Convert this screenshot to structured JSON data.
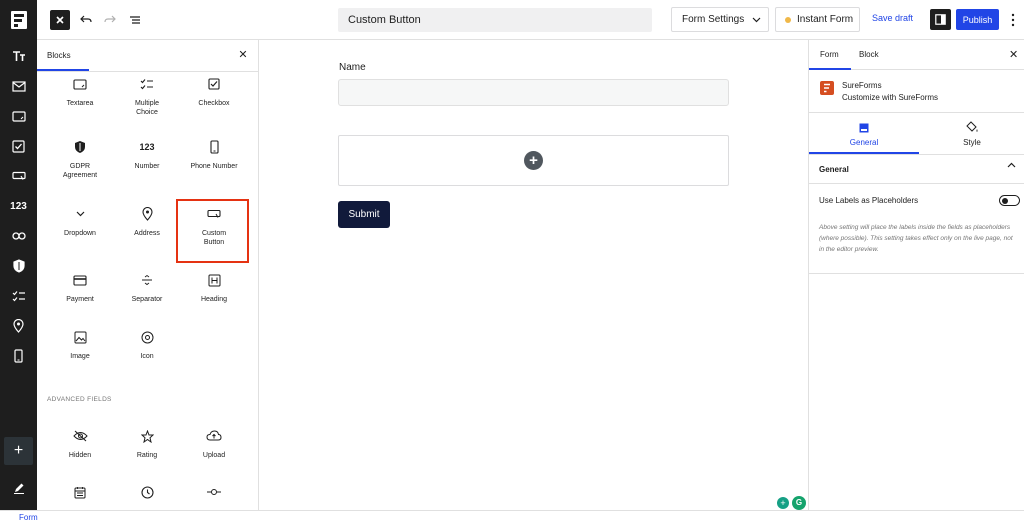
{
  "topbar": {
    "title": "Custom Button",
    "form_settings": "Form Settings",
    "instant_form": "Instant Form",
    "save_draft": "Save draft",
    "publish": "Publish"
  },
  "rail": {
    "number_label": "123"
  },
  "blocks_panel": {
    "tab": "Blocks",
    "items": [
      {
        "label": "Textarea",
        "icon": "textarea-icon"
      },
      {
        "label": "Multiple Choice",
        "icon": "multiple-choice-icon"
      },
      {
        "label": "Checkbox",
        "icon": "checkbox-icon"
      },
      {
        "label": "GDPR Agreement",
        "icon": "shield-icon"
      },
      {
        "label": "Number",
        "icon": "number-icon",
        "glyph": "123"
      },
      {
        "label": "Phone Number",
        "icon": "phone-icon"
      },
      {
        "label": "Dropdown",
        "icon": "chevron-down-icon"
      },
      {
        "label": "Address",
        "icon": "location-pin-icon"
      },
      {
        "label": "Custom Button",
        "icon": "button-icon"
      },
      {
        "label": "Payment",
        "icon": "credit-card-icon"
      },
      {
        "label": "Separator",
        "icon": "separator-icon"
      },
      {
        "label": "Heading",
        "icon": "heading-icon"
      },
      {
        "label": "Image",
        "icon": "image-icon"
      },
      {
        "label": "Icon",
        "icon": "icon-icon"
      }
    ],
    "advanced_title": "ADVANCED FIELDS",
    "advanced_items": [
      {
        "label": "Hidden",
        "icon": "eye-off-icon"
      },
      {
        "label": "Rating",
        "icon": "star-icon"
      },
      {
        "label": "Upload",
        "icon": "cloud-upload-icon"
      },
      {
        "label": "",
        "icon": "calendar-icon"
      },
      {
        "label": "",
        "icon": "clock-icon"
      },
      {
        "label": "",
        "icon": "slider-icon"
      }
    ]
  },
  "canvas": {
    "name_label": "Name",
    "submit_label": "Submit"
  },
  "settings": {
    "tabs": [
      "Form",
      "Block"
    ],
    "plugin_name": "SureForms",
    "plugin_desc": "Customize with SureForms",
    "sub_tabs": [
      "General",
      "Style"
    ],
    "section_title": "General",
    "toggle_label": "Use Labels as Placeholders",
    "toggle_on": false,
    "help_text": "Above setting will place the labels inside the fields as placeholders (where possible). This setting takes effect only on the live page, not in the editor preview."
  },
  "footer": {
    "breadcrumb": "Form"
  },
  "colors": {
    "accent": "#2145e6",
    "highlight": "#e53212",
    "submit": "#111a3b",
    "brand": "#d54e21"
  }
}
